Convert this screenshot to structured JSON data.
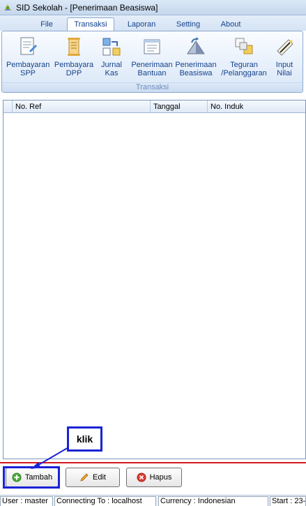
{
  "window": {
    "title": "SID Sekolah - [Penerimaan Beasiswa]",
    "app_icon": "app-logo-icon"
  },
  "menu": {
    "tabs": [
      {
        "label": "File"
      },
      {
        "label": "Transaksi"
      },
      {
        "label": "Laporan"
      },
      {
        "label": "Setting"
      },
      {
        "label": "About"
      }
    ],
    "active_tab": "Transaksi"
  },
  "ribbon": {
    "group_label": "Transaksi",
    "buttons": [
      {
        "line1": "Pembayaran",
        "line2": "SPP",
        "icon": "document-edit-icon"
      },
      {
        "line1": "Pembayara",
        "line2": "DPP",
        "icon": "scroll-icon"
      },
      {
        "line1": "Jurnal",
        "line2": "Kas",
        "icon": "journal-icon"
      },
      {
        "line1": "Penerimaan",
        "line2": "Bantuan",
        "icon": "form-icon"
      },
      {
        "line1": "Penerimaan",
        "line2": "Beasiswa",
        "icon": "triangle-refresh-icon"
      },
      {
        "line1": "Teguran",
        "line2": "/Pelanggaran",
        "icon": "cards-icon"
      },
      {
        "line1": "Input",
        "line2": "Nilai",
        "icon": "pencil-note-icon"
      }
    ]
  },
  "grid": {
    "columns": [
      {
        "label": "No. Ref"
      },
      {
        "label": "Tanggal"
      },
      {
        "label": "No. Induk"
      }
    ],
    "rows": []
  },
  "actions": {
    "add_label": "Tambah",
    "edit_label": "Edit",
    "delete_label": "Hapus"
  },
  "annotation": {
    "label": "klik",
    "color": "#1a23d6"
  },
  "status": {
    "user": "User : master",
    "connection": "Connecting To : localhost",
    "currency": "Currency : Indonesian",
    "start": "Start : 23-"
  },
  "colors": {
    "accent": "#15428b",
    "separator": "#d6181c",
    "highlight": "#1a23d6"
  }
}
